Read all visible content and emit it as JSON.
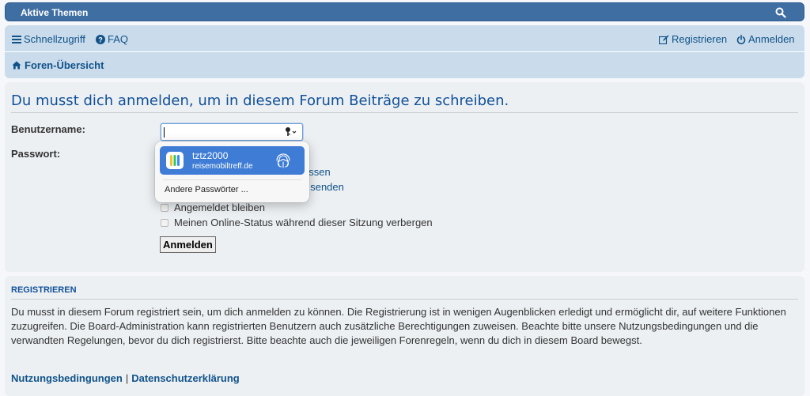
{
  "topbar": {
    "tab_label": "Aktive Themen",
    "search_icon": "search-icon"
  },
  "nav": {
    "quicklinks_label": "Schnellzugriff",
    "faq_label": "FAQ",
    "register_label": "Registrieren",
    "login_label": "Anmelden",
    "breadcrumb_label": "Foren-Übersicht"
  },
  "login": {
    "heading": "Du musst dich anmelden, um in diesem Forum Beiträge zu schreiben.",
    "username_label": "Benutzername:",
    "username_value": "",
    "password_label": "Passwort:",
    "forgot_password_fragment": "essen",
    "resend_activation_fragment": "t senden",
    "remember_me_label": "Angemeldet bleiben",
    "hide_online_label": "Meinen Online-Status während dieser Sitzung verbergen",
    "submit_label": "Anmelden"
  },
  "autofill": {
    "username": "tztz2000",
    "domain": "reisemobiltreff.de",
    "other_passwords_label": "Andere Passwörter ..."
  },
  "register": {
    "heading": "REGISTRIEREN",
    "text": "Du musst in diesem Forum registriert sein, um dich anmelden zu können. Die Registrierung ist in wenigen Augenblicken erledigt und ermöglicht dir, auf weitere Funktionen zuzugreifen. Die Board-Administration kann registrierten Benutzern auch zusätzliche Berechtigungen zuweisen. Beachte bitte unsere Nutzungsbedingungen und die verwandten Regelungen, bevor du dich registrierst. Bitte beachte auch die jeweiligen Forenregeln, wenn du dich in diesem Board bewegst.",
    "terms_label": "Nutzungsbedingungen",
    "link_separator": "|",
    "privacy_label": "Datenschutzerklärung"
  },
  "colors": {
    "accent": "#105289",
    "topbar": "#3f6ea3",
    "nav_bg": "#cadceb",
    "panel_bg": "#ecf0f3",
    "autofill_selected": "#3e7cd6"
  }
}
